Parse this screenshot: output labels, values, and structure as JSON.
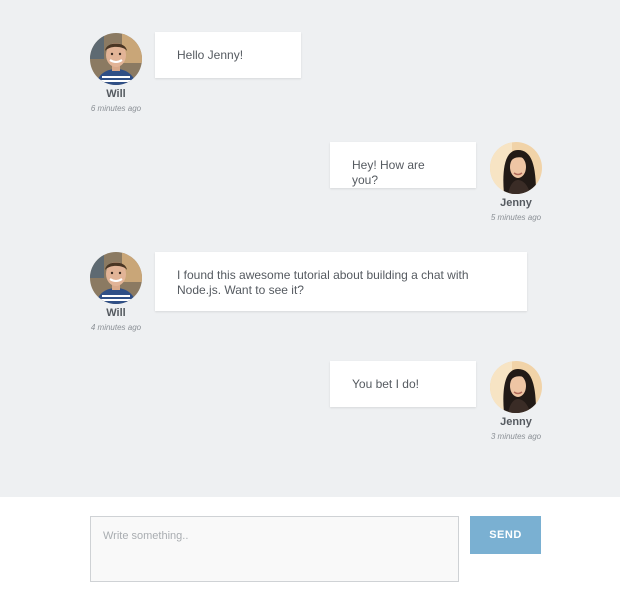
{
  "colors": {
    "chat_background": "#eef0f2",
    "bubble_background": "#ffffff",
    "send_button": "#7ab0d2",
    "text": "#555a60",
    "meta_text": "#8a8f95"
  },
  "messages": [
    {
      "author": "Will",
      "time": "6 minutes ago",
      "text": "Hello Jenny!",
      "side": "left",
      "avatar": "will-avatar"
    },
    {
      "author": "Jenny",
      "time": "5 minutes ago",
      "text": "Hey! How are you?",
      "side": "right",
      "avatar": "jenny-avatar"
    },
    {
      "author": "Will",
      "time": "4 minutes ago",
      "text": "I found this awesome tutorial about building a chat with Node.js. Want to see it?",
      "side": "left",
      "avatar": "will-avatar"
    },
    {
      "author": "Jenny",
      "time": "3 minutes ago",
      "text": "You bet I do!",
      "side": "right",
      "avatar": "jenny-avatar"
    }
  ],
  "composer": {
    "placeholder": "Write something..",
    "value": "",
    "send_label": "SEND"
  }
}
